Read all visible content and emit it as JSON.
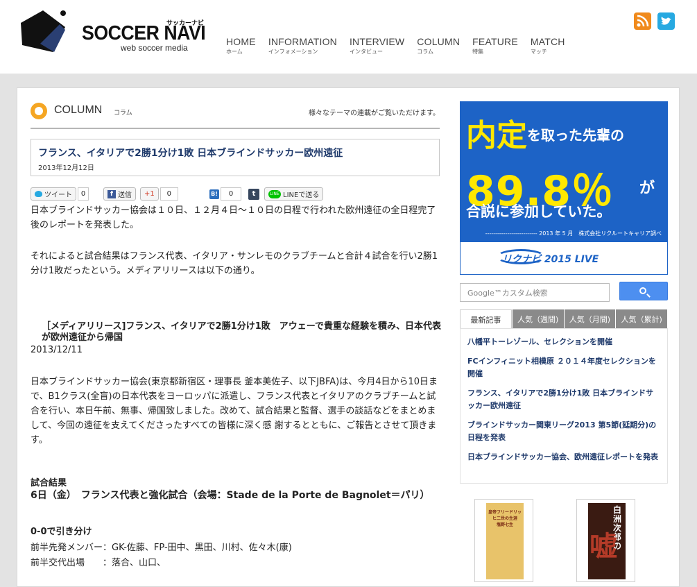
{
  "header": {
    "logo_title": "SOCCER NAVI",
    "logo_kana": "サッカーナビ",
    "logo_sub": "web soccer media",
    "nav": [
      {
        "en": "HOME",
        "jp": "ホーム"
      },
      {
        "en": "INFORMATION",
        "jp": "インフォメーション"
      },
      {
        "en": "INTERVIEW",
        "jp": "インタビュー"
      },
      {
        "en": "COLUMN",
        "jp": "コラム"
      },
      {
        "en": "FEATURE",
        "jp": "特集"
      },
      {
        "en": "MATCH",
        "jp": "マッチ"
      }
    ],
    "social_icons": [
      "rss-icon",
      "twitter-icon"
    ]
  },
  "section": {
    "title": "COLUMN",
    "sub": "コラム",
    "desc": "様々なテーマの連載がご覧いただけます。"
  },
  "article": {
    "title": "フランス、イタリアで2勝1分け1敗 日本ブラインドサッカー欧州遠征",
    "date": "2013年12月12日",
    "share": {
      "tweet": "ツイート",
      "tweet_count": "0",
      "fb": "送信",
      "gplus": "+1",
      "gplus_count": "0",
      "hatena": "B!",
      "hatena_count": "0",
      "tumblr": "t",
      "line": "LINEで送る"
    },
    "p1": "日本ブラインドサッカー協会は１０日、１２月４日〜１０日の日程で行われた欧州遠征の全日程完了後のレポートを発表した。",
    "p2": "それによると試合結果はフランス代表、イタリア・サンレモのクラブチームと合計４試合を行い2勝1分け1敗だったという。メディアリリースは以下の通り。",
    "release_title": "［メディアリリース]フランス、イタリアで2勝1分け1敗　アウェーで貴重な経験を積み、日本代表が欧州遠征から帰国",
    "release_date": "2013/12/11",
    "p3": "日本ブラインドサッカー協会(東京都新宿区・理事長 釜本美佐子、以下JBFA)は、今月4日から10日まで、B1クラス(全盲)の日本代表をヨーロッパに派遣し、フランス代表とイタリアのクラブチームと試 合を行い、本日午前、無事、帰国致しました。改めて、試合結果と監督、選手の談話などをまとめまして、今回の遠征を支えてくださったすべての皆様に深く感 謝するとともに、ご報告とさせて頂きます。",
    "results_label": "試合結果",
    "match1": "6日（金）　フランス代表と強化試合（会場：Stade de la Porte de Bagnolet＝パリ）",
    "score1": "0-0で引き分け",
    "lineup": "前半先発メンバー：GK-佐藤、FP-田中、黒田、川村、佐々木(康)",
    "subs": "前半交代出場　　：落合、山口、"
  },
  "ad": {
    "w1": "内定",
    "w2": "を取った先輩の",
    "pct": "89.8％",
    "ga": "が",
    "w3": "合説に参加していた。",
    "note": "-------------------------- 2013 年 5 月　株式会社リクルートキャリア調べ",
    "logo": "リクナビ 2015 LIVE"
  },
  "search": {
    "placeholder": "Google™カスタム検索"
  },
  "tabs": [
    "最新記事",
    "人気（週間)",
    "人気（月間)",
    "人気（累計)"
  ],
  "news": [
    "八幡平トーレゾール、セレクションを開催",
    "FCインフィニット相模原 ２０１４年度セレクションを開催",
    "フランス、イタリアで2勝1分け1敗 日本ブラインドサッカー欧州遠征",
    "ブラインドサッカー関東リーグ2013 第5節(延期分)の日程を発表",
    "日本ブラインドサッカー協会、欧州遠征レポートを発表"
  ],
  "books": {
    "b1_title": "皇帝フリードリッヒ二世の生涯",
    "b1_author": "塩野七生",
    "b2_title": "白洲次郎の",
    "b2_big": "嘘"
  },
  "colors": {
    "accent_orange": "#f5a623",
    "link_navy": "#1f3a6b",
    "ad_blue": "#1d63c6",
    "ad_yellow": "#ffe800"
  }
}
